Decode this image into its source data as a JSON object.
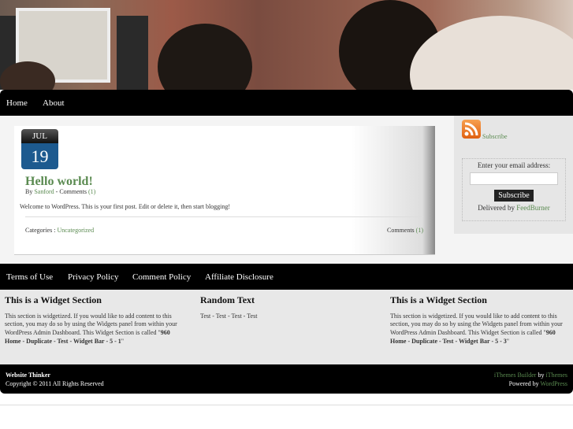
{
  "nav": {
    "items": [
      "Home",
      "About"
    ]
  },
  "post": {
    "month": "JUL",
    "day": "19",
    "title": "Hello world!",
    "by": "By",
    "author": "Sanford",
    "comments_label": "- Comments",
    "comments_count": "(1)",
    "body": "Welcome to WordPress. This is your first post. Edit or delete it, then start blogging!",
    "categories_label": "Categories :",
    "category": "Uncategorized",
    "footer_comments_label": "Comments",
    "footer_comments_count": "(1)"
  },
  "sidebar": {
    "subscribe_link": "Subscribe",
    "email_label": "Enter your email address:",
    "email_value": "",
    "subscribe_button": "Subscribe",
    "delivered_by": "Delivered by",
    "feedburner": "FeedBurner"
  },
  "footer_nav": {
    "items": [
      "Terms of Use",
      "Privacy Policy",
      "Comment Policy",
      "Affiliate Disclosure"
    ]
  },
  "widgets": [
    {
      "title": "This is a Widget Section",
      "text": "This section is widgetized. If you would like to add content to this section, you may do so by using the Widgets panel from within your WordPress Admin Dashboard. This Widget Section is called \"",
      "name": "960 Home - Duplicate - Test - Widget Bar - 5 - 1",
      "end": "\""
    },
    {
      "title": "Random Text",
      "text": "Test - Test - Test - Test"
    },
    {
      "title": "This is a Widget Section",
      "text": "This section is widgetized. If you would like to add content to this section, you may do so by using the Widgets panel from within your WordPress Admin Dashboard. This Widget Section is called \"",
      "name": "960 Home - Duplicate - Test - Widget Bar - 5 - 3",
      "end": "\""
    }
  ],
  "footer": {
    "site": "Website Thinker",
    "copyright": "Copyright © 2011  All Rights Reserved",
    "builder": "iThemes Builder",
    "by": "by",
    "ithemes": "iThemes",
    "powered": "Powered by",
    "wordpress": "WordPress"
  }
}
